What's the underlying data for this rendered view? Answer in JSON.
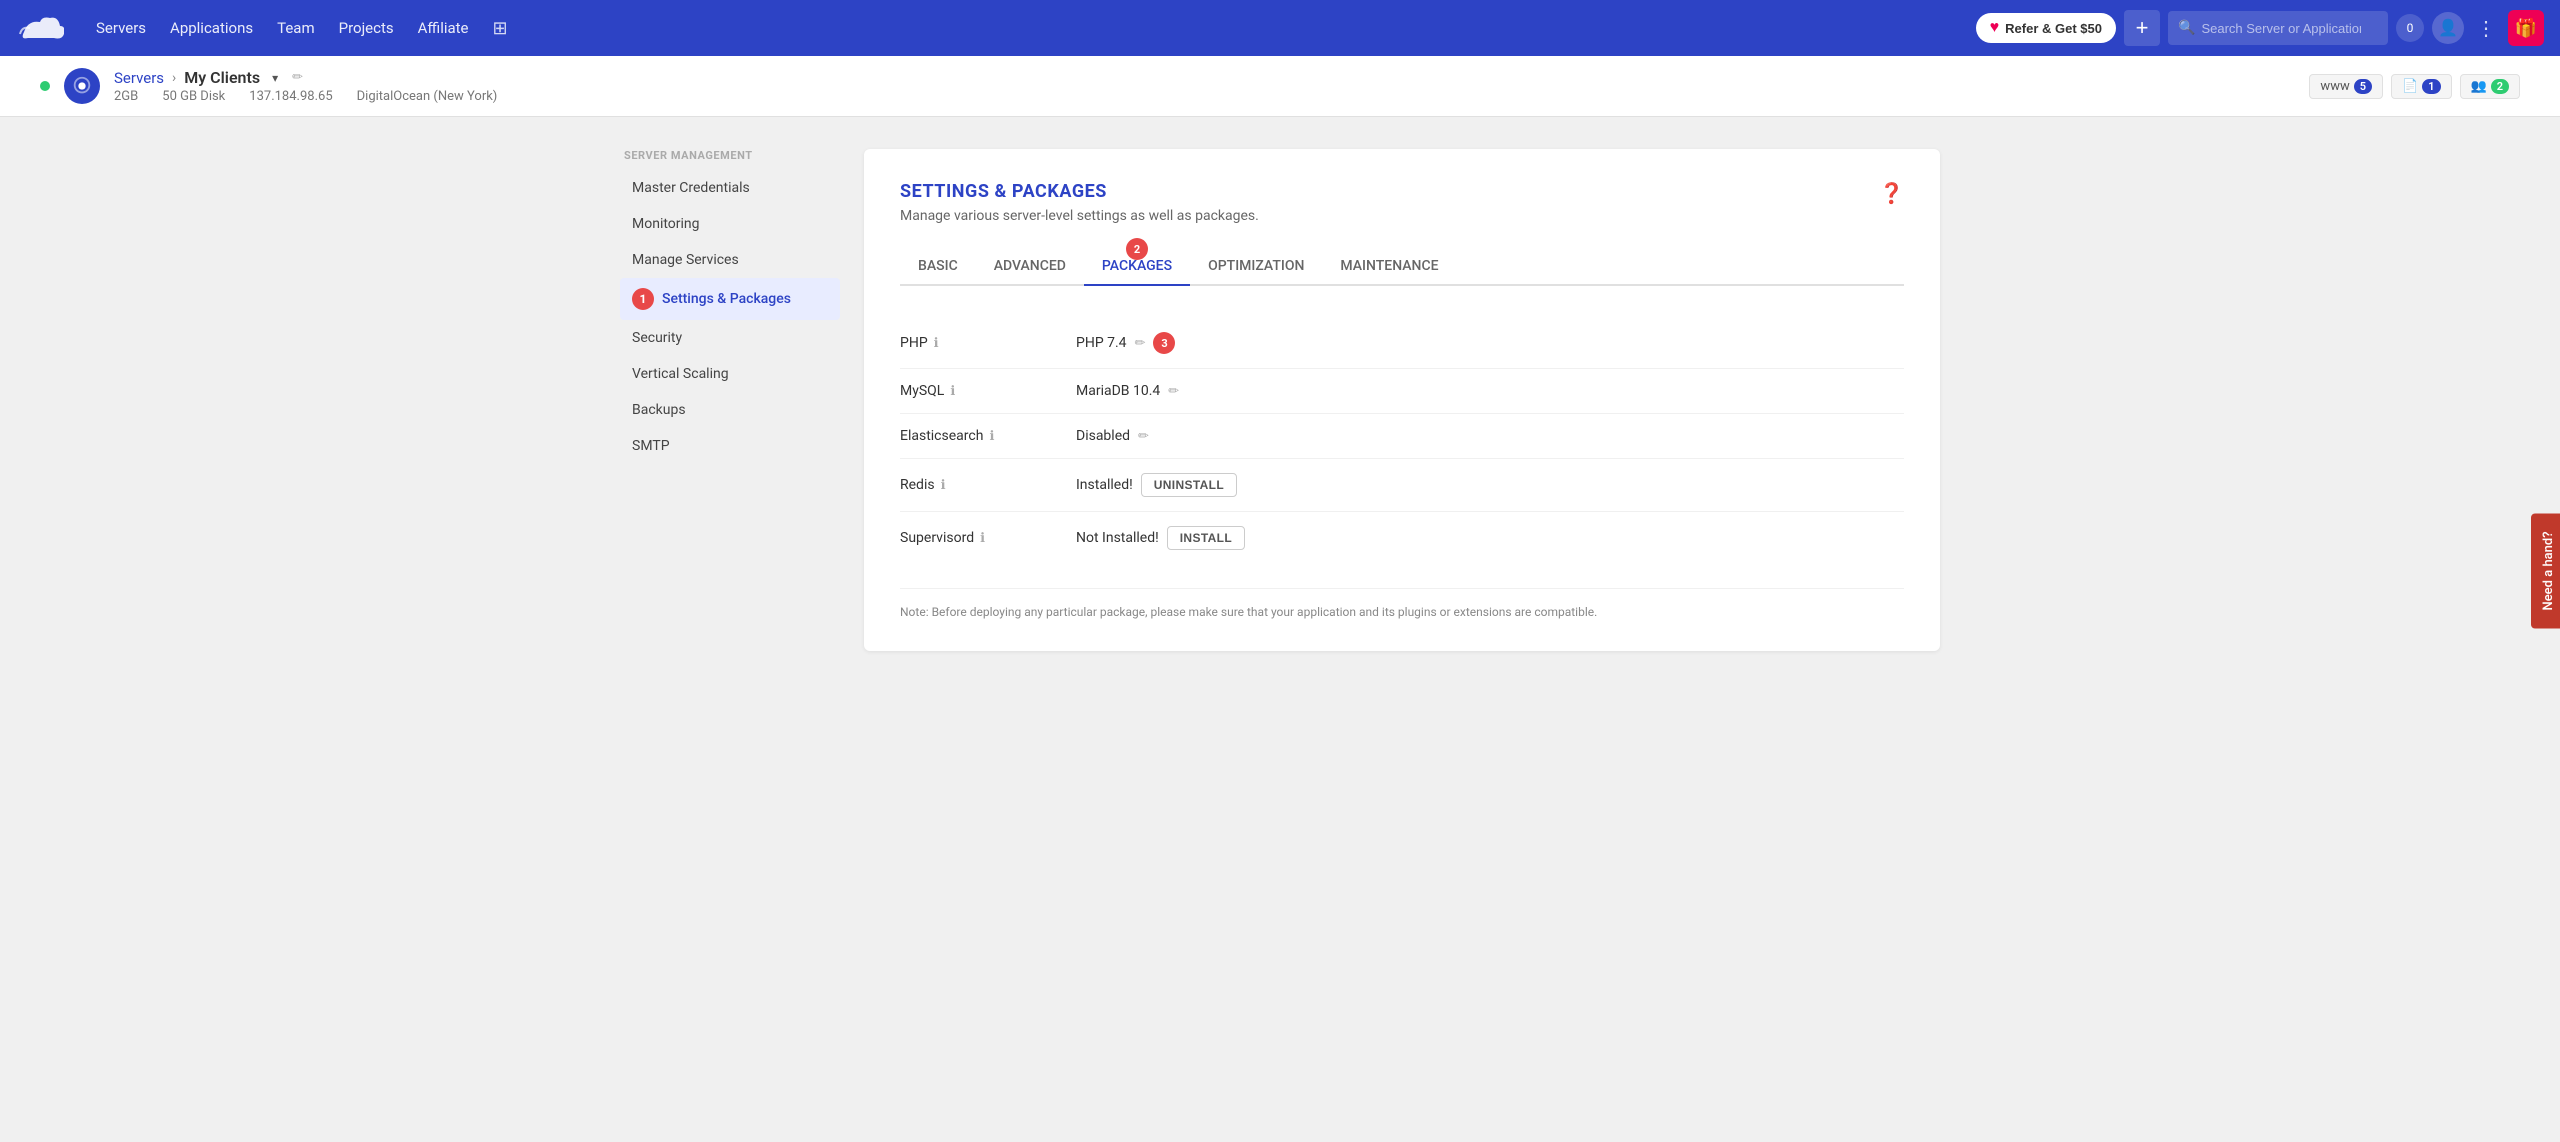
{
  "navbar": {
    "brand": "Cloudways",
    "nav_items": [
      "Servers",
      "Applications",
      "Team",
      "Projects",
      "Affiliate"
    ],
    "refer_label": "Refer & Get $50",
    "plus_label": "+",
    "search_placeholder": "Search Server or Application",
    "notification_count": "0"
  },
  "server_header": {
    "breadcrumb_servers": "Servers",
    "server_name": "My Clients",
    "disk": "2GB",
    "storage": "50 GB Disk",
    "ip": "137.184.98.65",
    "provider": "DigitalOcean (New York)",
    "www_label": "www",
    "www_count": "5",
    "file_count": "1",
    "user_count": "2"
  },
  "sidebar": {
    "section_title": "Server Management",
    "items": [
      {
        "label": "Master Credentials",
        "active": false
      },
      {
        "label": "Monitoring",
        "active": false
      },
      {
        "label": "Manage Services",
        "active": false
      },
      {
        "label": "Settings & Packages",
        "active": true,
        "step": "1"
      },
      {
        "label": "Security",
        "active": false
      },
      {
        "label": "Vertical Scaling",
        "active": false
      },
      {
        "label": "Backups",
        "active": false
      },
      {
        "label": "SMTP",
        "active": false
      }
    ]
  },
  "content": {
    "title": "SETTINGS & PACKAGES",
    "subtitle": "Manage various server-level settings as well as packages.",
    "tabs": [
      {
        "label": "BASIC",
        "active": false
      },
      {
        "label": "ADVANCED",
        "active": false
      },
      {
        "label": "PACKAGES",
        "active": true,
        "step": "2"
      },
      {
        "label": "OPTIMIZATION",
        "active": false
      },
      {
        "label": "MAINTENANCE",
        "active": false
      }
    ],
    "packages": [
      {
        "name": "PHP",
        "value": "PHP 7.4",
        "has_edit": true,
        "step": "3",
        "status": "",
        "btn": ""
      },
      {
        "name": "MySQL",
        "value": "MariaDB 10.4",
        "has_edit": true,
        "step": "",
        "status": "",
        "btn": ""
      },
      {
        "name": "Elasticsearch",
        "value": "Disabled",
        "has_edit": true,
        "step": "",
        "status": "",
        "btn": ""
      },
      {
        "name": "Redis",
        "value": "Installed!",
        "has_edit": false,
        "step": "",
        "status": "installed",
        "btn": "UNINSTALL"
      },
      {
        "name": "Supervisord",
        "value": "Not Installed!",
        "has_edit": false,
        "step": "",
        "status": "not_installed",
        "btn": "INSTALL"
      }
    ],
    "note": "Note: Before deploying any particular package, please make sure that your application and its plugins or extensions are compatible."
  },
  "feedback": {
    "label": "Need a hand?"
  }
}
